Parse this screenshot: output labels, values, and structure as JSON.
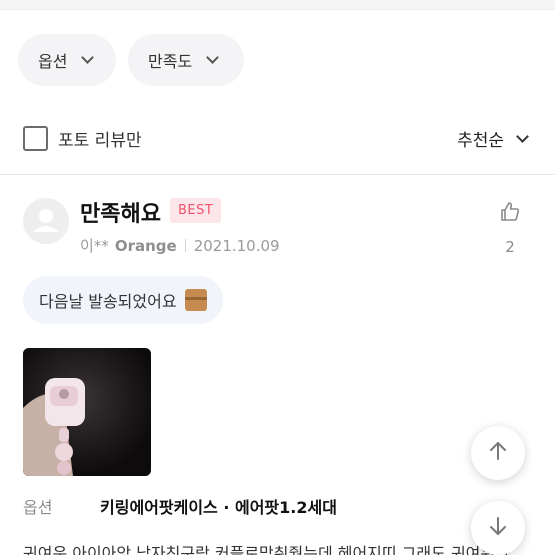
{
  "filters": {
    "option_label": "옵션",
    "satisfaction_label": "만족도",
    "photo_only_label": "포토 리뷰만",
    "sort_label": "추천순"
  },
  "review": {
    "title": "만족해요",
    "badge": "BEST",
    "author": "이**",
    "option_short": "Orange",
    "date": "2021.10.09",
    "like_count": "2",
    "tag": "다음날 발송되었어요",
    "option_key": "옵션",
    "option_value": "키링에어팟케이스 · 에어팟1.2세대",
    "body": "귀여운 아이아앙 남자친구랑 커플로맞춰줬는데 헤어지띠 그래도 귀여워가"
  },
  "icons": {
    "checkbox": "checkbox-empty-icon",
    "chevron": "chevron-down-icon",
    "thumbs_up": "thumbs-up-icon",
    "avatar": "user-avatar-icon",
    "package": "package-box-icon",
    "arrow_up": "arrow-up-icon",
    "arrow_down": "arrow-down-icon"
  },
  "colors": {
    "best_badge_bg": "#fde6ea",
    "best_badge_text": "#f1536b",
    "chip_bg": "#f4f4f6",
    "tag_bg": "#f1f4fb"
  }
}
